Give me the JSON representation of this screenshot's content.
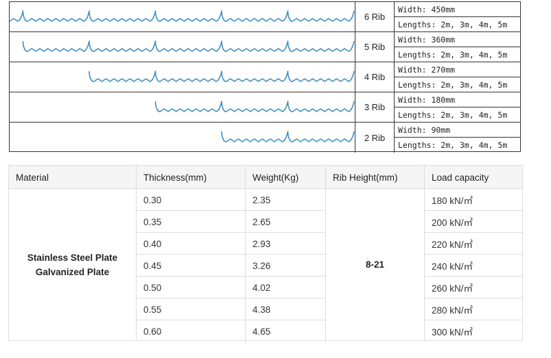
{
  "rib_profiles": [
    {
      "ribs": 6,
      "name": "6 Rib",
      "width": "Width: 450mm",
      "lengths": "Lengths: 2m, 3m, 4m, 5m"
    },
    {
      "ribs": 5,
      "name": "5 Rib",
      "width": "Width: 360mm",
      "lengths": "Lengths: 2m, 3m, 4m, 5m"
    },
    {
      "ribs": 4,
      "name": "4 Rib",
      "width": "Width: 270mm",
      "lengths": "Lengths: 2m, 3m, 4m, 5m"
    },
    {
      "ribs": 3,
      "name": "3 Rib",
      "width": "Width: 180mm",
      "lengths": "Lengths: 2m, 3m, 4m, 5m"
    },
    {
      "ribs": 2,
      "name": "2 Rib",
      "width": "Width: 90mm",
      "lengths": "Lengths: 2m, 3m, 4m, 5m"
    }
  ],
  "profile_color": "#3d8fc4",
  "spec_table": {
    "headers": [
      "Material",
      "Thickness(mm)",
      "Weight(Kg)",
      "Rib Height(mm)",
      "Load capacity"
    ],
    "material": [
      "Stainless Steel Plate",
      "Galvanized Plate"
    ],
    "rib_height": "8-21",
    "rows": [
      {
        "thickness": "0.30",
        "weight": "2.35",
        "load": "180 kN/㎡"
      },
      {
        "thickness": "0.35",
        "weight": "2.65",
        "load": "200 kN/㎡"
      },
      {
        "thickness": "0.40",
        "weight": "2.93",
        "load": "220 kN/㎡"
      },
      {
        "thickness": "0.45",
        "weight": "3.26",
        "load": "240 kN/㎡"
      },
      {
        "thickness": "0.50",
        "weight": "4.02",
        "load": "260 kN/㎡"
      },
      {
        "thickness": "0.55",
        "weight": "4.38",
        "load": "280 kN/㎡"
      },
      {
        "thickness": "0.60",
        "weight": "4.65",
        "load": "300 kN/㎡"
      }
    ]
  }
}
